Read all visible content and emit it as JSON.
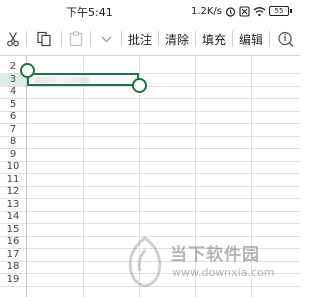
{
  "status": {
    "time": "下午5:41",
    "net_speed": "1.2K/s",
    "battery": "55"
  },
  "toolbar": {
    "cut_icon": "scissors-icon",
    "copy_icon": "copy-icon",
    "paste_icon": "paste-icon",
    "more_icon": "chevron-down-icon",
    "comment_label": "批注",
    "clear_label": "清除",
    "fill_label": "填充",
    "edit_label": "编辑",
    "find_icon": "search-icon"
  },
  "sheet": {
    "rows": [
      "2",
      "3",
      "4",
      "5",
      "6",
      "7",
      "8",
      "9",
      "10",
      "11",
      "12",
      "13",
      "14",
      "15",
      "16",
      "17",
      "18",
      "19"
    ],
    "selected_row": "3"
  },
  "watermark": {
    "text": "当下软件园",
    "url": "www.downxia.com"
  }
}
